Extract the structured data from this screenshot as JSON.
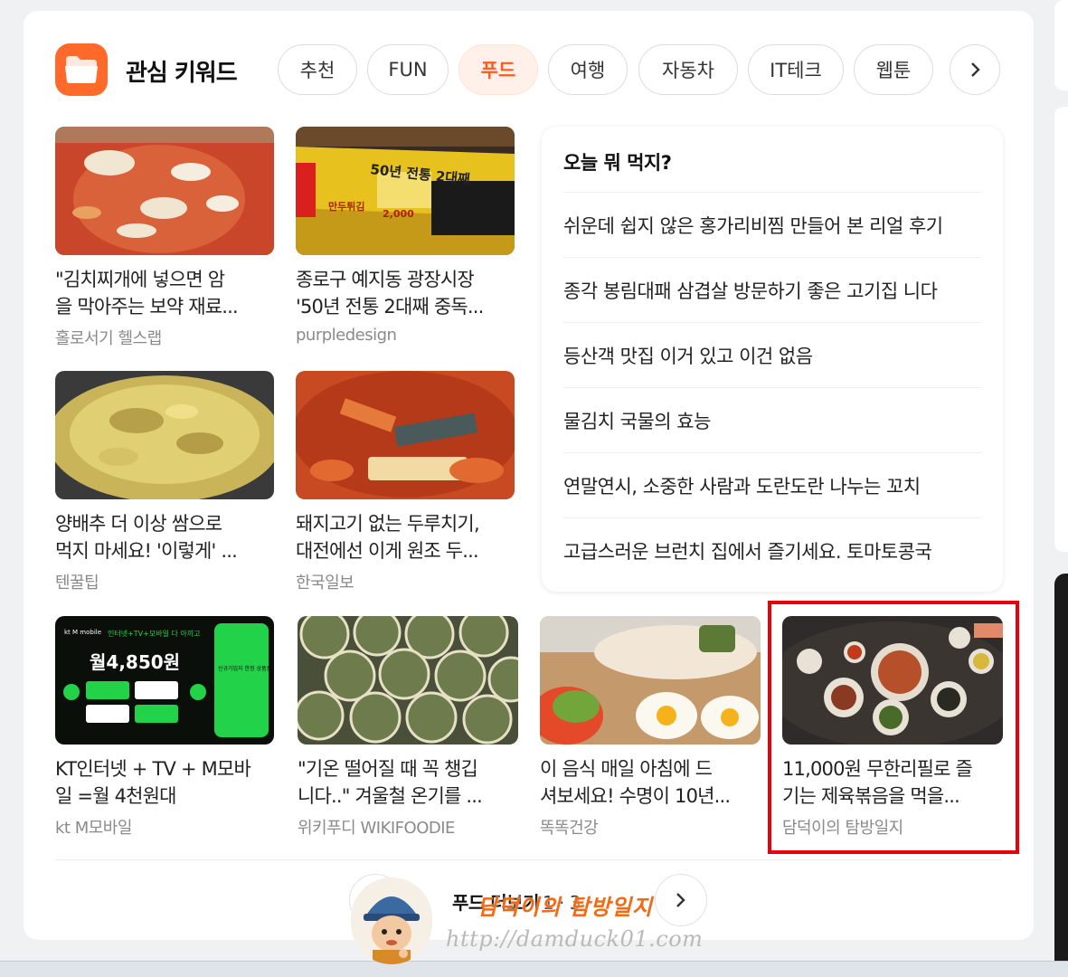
{
  "header": {
    "title": "관심 키워드",
    "icon": "folder-icon"
  },
  "chips": [
    {
      "label": "추천",
      "active": false
    },
    {
      "label": "FUN",
      "active": false
    },
    {
      "label": "푸드",
      "active": true
    },
    {
      "label": "여행",
      "active": false
    },
    {
      "label": "자동차",
      "active": false
    },
    {
      "label": "IT테크",
      "active": false
    },
    {
      "label": "웹툰",
      "active": false
    }
  ],
  "colors": {
    "accent": "#ff6a2b",
    "active_chip_text": "#ff5a1f",
    "highlight_border": "#e8000b"
  },
  "feed": [
    {
      "title_line1": "\"김치찌개에 넣으면 암",
      "title_line2": "을 막아주는 보약 재료...",
      "source": "홀로서기 헬스랩"
    },
    {
      "title_line1": "종로구 예지동 광장시장",
      "title_line2": "'50년 전통 2대째 중독...",
      "source": "purpledesign"
    },
    {
      "title_line1": "양배추 더 이상 쌈으로",
      "title_line2": "먹지 마세요! '이렇게' ...",
      "source": "텐꿀팁"
    },
    {
      "title_line1": "돼지고기 없는 두루치기,",
      "title_line2": "대전에선 이게 원조 두...",
      "source": "한국일보"
    },
    {
      "title_line1": "KT인터넷 + TV + M모바",
      "title_line2": "일 =월 4천원대",
      "source": "kt M모바일"
    },
    {
      "title_line1": "\"기온 떨어질 때 꼭 챙깁",
      "title_line2": "니다..\" 겨울철 온기를 ...",
      "source": "위키푸디 WIKIFOODIE"
    },
    {
      "title_line1": "이 음식 매일 아침에 드",
      "title_line2": "셔보세요! 수명이 10년...",
      "source": "똑똑건강"
    },
    {
      "title_line1": "11,000원 무한리필로 즐",
      "title_line2": "기는 제육볶음을 먹을...",
      "source": "담덕이의 탐방일지"
    }
  ],
  "ad_thumb": {
    "brand": "kt M mobile",
    "price": "월4,850원",
    "promo": "인터넷+TV+모바일 다 아끼고",
    "side_text": "신규가입자 한정 상품권 추가지급 이벤트 진행 중"
  },
  "market_thumb": {
    "sign": "50년 전통 2대째",
    "menu1": "만두튀김",
    "price1": "2,000"
  },
  "today": {
    "title": "오늘 뭐 먹지?",
    "items": [
      "쉬운데 쉽지 않은 홍가리비찜 만들어 본 리얼 후기",
      "종각 봉림대패 삼겹살 방문하기 좋은 고기집 니다",
      "등산객 맛집 이거 있고 이건 없음",
      "물김치 국물의 효능",
      "연말연시, 소중한 사람과 도란도란 나누는 꼬치",
      "고급스러운 브런치 집에서 즐기세요. 토마토콩국"
    ]
  },
  "more": {
    "label": "푸드 더보기",
    "page": "1 · 3"
  },
  "watermark": {
    "name": "담덕이의 탐방일지",
    "url": "http://damduck01.com"
  }
}
